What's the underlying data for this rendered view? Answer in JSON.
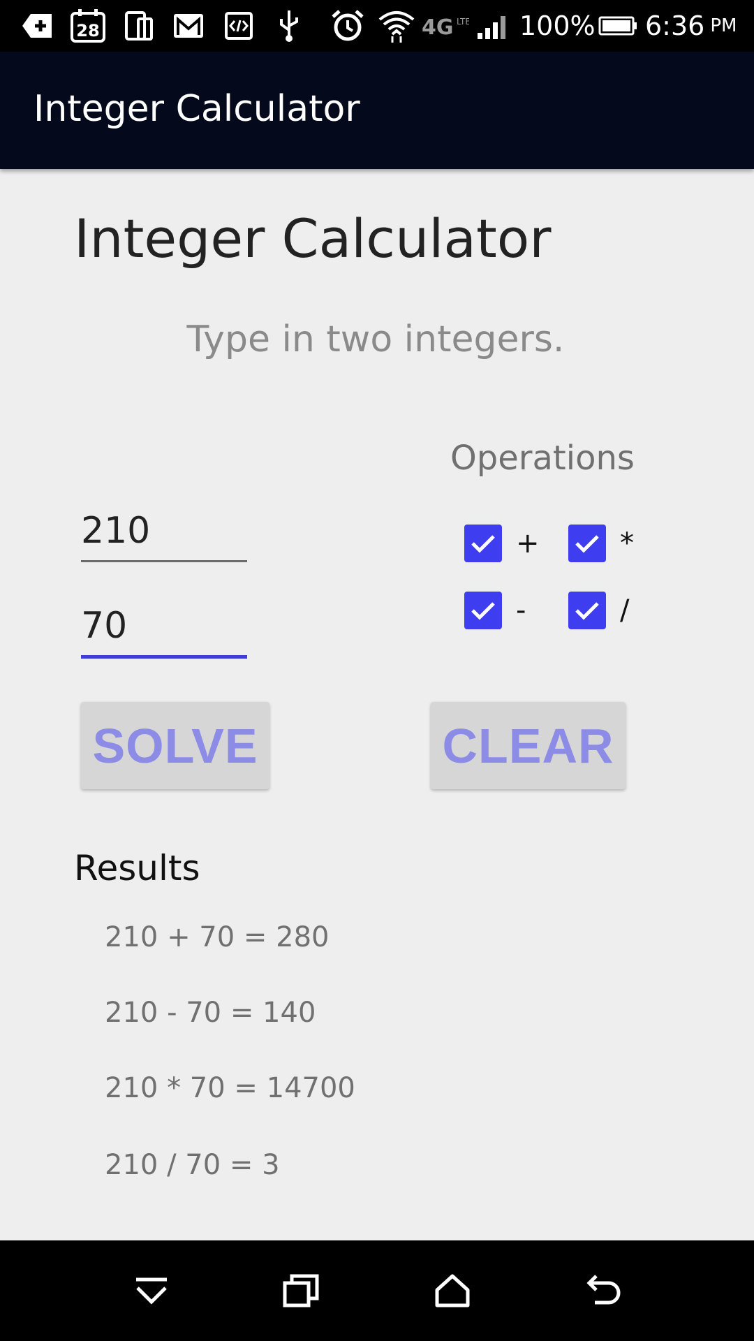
{
  "status_bar": {
    "battery": "100%",
    "time": "6:36",
    "meridiem": "PM",
    "calendar_day": "28",
    "network": "4G",
    "icons": [
      "add-icon",
      "calendar-icon",
      "devices-icon",
      "gmail-icon",
      "code-icon",
      "usb-icon",
      "alarm-icon",
      "wifi-icon",
      "lte-icon",
      "signal-icon",
      "battery-icon"
    ]
  },
  "app_bar": {
    "title": "Integer Calculator"
  },
  "main": {
    "heading": "Integer Calculator",
    "instruction": "Type in two integers.",
    "first_integer": "210",
    "second_integer": "70",
    "operations_label": "Operations",
    "operations": [
      {
        "label": "+",
        "checked": true
      },
      {
        "label": "*",
        "checked": true
      },
      {
        "label": "-",
        "checked": true
      },
      {
        "label": "/",
        "checked": true
      }
    ],
    "solve_label": "SOLVE",
    "clear_label": "CLEAR",
    "results_title": "Results",
    "results": [
      "210 + 70 = 280",
      "210 - 70 = 140",
      "210 * 70 = 14700",
      "210 / 70 = 3"
    ]
  },
  "colors": {
    "app_bar": "#040a1c",
    "accent": "#3e3ef0",
    "button_text": "#8c8ce6",
    "background": "#eeeeee"
  },
  "nav_bar": {
    "icons": [
      "recents-down-icon",
      "overview-icon",
      "home-icon",
      "back-icon"
    ]
  }
}
